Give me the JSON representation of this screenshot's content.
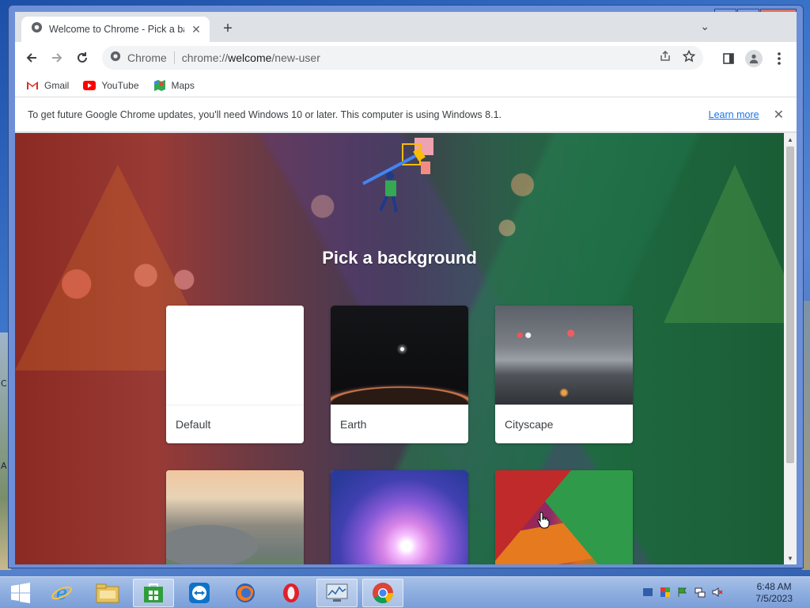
{
  "browser": {
    "tab": {
      "title": "Welcome to Chrome - Pick a background",
      "favicon": "chrome-icon"
    },
    "address": {
      "site_label": "Chrome",
      "url_scheme": "chrome://",
      "url_host": "welcome",
      "url_path": "/new-user"
    }
  },
  "bookmarks": [
    {
      "label": "Gmail",
      "icon": "gmail-icon"
    },
    {
      "label": "YouTube",
      "icon": "youtube-icon"
    },
    {
      "label": "Maps",
      "icon": "maps-icon"
    }
  ],
  "infobar": {
    "message": "To get future Google Chrome updates, you'll need Windows 10 or later. This computer is using Windows 8.1.",
    "link": "Learn more"
  },
  "page": {
    "title": "Pick a background",
    "cards": [
      {
        "label": "Default"
      },
      {
        "label": "Earth"
      },
      {
        "label": "Cityscape"
      },
      {
        "label": ""
      },
      {
        "label": ""
      },
      {
        "label": ""
      }
    ]
  },
  "taskbar": {
    "apps": [
      "start-icon",
      "ie-icon",
      "file-explorer-icon",
      "store-icon",
      "teamviewer-icon",
      "firefox-icon",
      "opera-icon",
      "performance-monitor-icon",
      "chrome-icon"
    ],
    "clock": {
      "time": "6:48 AM",
      "date": "7/5/2023"
    }
  },
  "colors": {
    "accent": "#1a73e8",
    "taskbar": "#8eaee0",
    "window_frame": "#6c8fd8"
  }
}
